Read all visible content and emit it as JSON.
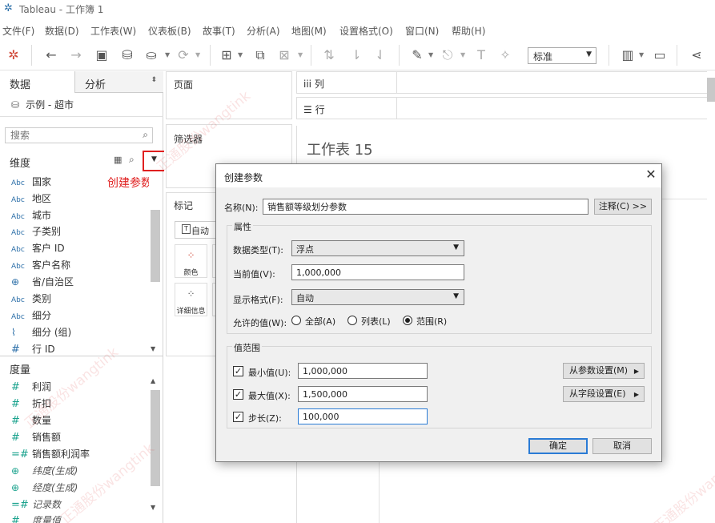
{
  "window": {
    "title": "Tableau - 工作簿 1"
  },
  "menu": [
    "文件(F)",
    "数据(D)",
    "工作表(W)",
    "仪表板(B)",
    "故事(T)",
    "分析(A)",
    "地图(M)",
    "设置格式(O)",
    "窗口(N)",
    "帮助(H)"
  ],
  "toolbar": {
    "fit_value": "标准"
  },
  "left": {
    "tab_data": "数据",
    "tab_analysis": "分析",
    "datasource": "示例 - 超市",
    "search_placeholder": "搜索",
    "dimensions_header": "维度",
    "dimensions": [
      {
        "type": "Abc",
        "name": "国家"
      },
      {
        "type": "Abc",
        "name": "地区"
      },
      {
        "type": "Abc",
        "name": "城市"
      },
      {
        "type": "Abc",
        "name": "子类别"
      },
      {
        "type": "Abc",
        "name": "客户 ID"
      },
      {
        "type": "Abc",
        "name": "客户名称"
      },
      {
        "type": "geo",
        "name": "省/自治区"
      },
      {
        "type": "Abc",
        "name": "类别"
      },
      {
        "type": "Abc",
        "name": "细分"
      },
      {
        "type": "clip",
        "name": "细分 (组)"
      },
      {
        "type": "#",
        "name": "行 ID"
      }
    ],
    "measures_header": "度量",
    "measures": [
      {
        "type": "#",
        "name": "利润"
      },
      {
        "type": "#",
        "name": "折扣"
      },
      {
        "type": "#",
        "name": "数量"
      },
      {
        "type": "#",
        "name": "销售额"
      },
      {
        "type": "=#",
        "name": "销售额利润率"
      },
      {
        "type": "geo",
        "name": "纬度(生成)"
      },
      {
        "type": "geo",
        "name": "经度(生成)"
      },
      {
        "type": "=#",
        "name": "记录数"
      },
      {
        "type": "#",
        "name": "度量值"
      }
    ]
  },
  "annotation": {
    "create_param": "创建参数"
  },
  "shelves": {
    "pages": "页面",
    "filters": "筛选器",
    "marks": "标记",
    "mark_type": "自动",
    "color": "颜色",
    "detail": "详细信息",
    "columns": "列",
    "rows": "行"
  },
  "sheet": {
    "title": "工作表 15"
  },
  "watermark": "正通股份wangtink",
  "dialog": {
    "title": "创建参数",
    "name_label": "名称(N):",
    "name_value": "销售额等级划分参数",
    "comment_button": "注释(C) >>",
    "properties_title": "属性",
    "data_type_label": "数据类型(T):",
    "data_type_value": "浮点",
    "current_label": "当前值(V):",
    "current_value": "1,000,000",
    "display_label": "显示格式(F):",
    "display_value": "自动",
    "allowed_label": "允许的值(W):",
    "allowed_options": [
      "全部(A)",
      "列表(L)",
      "范围(R)"
    ],
    "allowed_selected": "范围(R)",
    "range_title": "值范围",
    "min_label": "最小值(U):",
    "min_value": "1,000,000",
    "max_label": "最大值(X):",
    "max_value": "1,500,000",
    "step_label": "步长(Z):",
    "step_value": "100,000",
    "from_param_button": "从参数设置(M)",
    "from_field_button": "从字段设置(E)",
    "ok_button": "确定",
    "cancel_button": "取消"
  }
}
